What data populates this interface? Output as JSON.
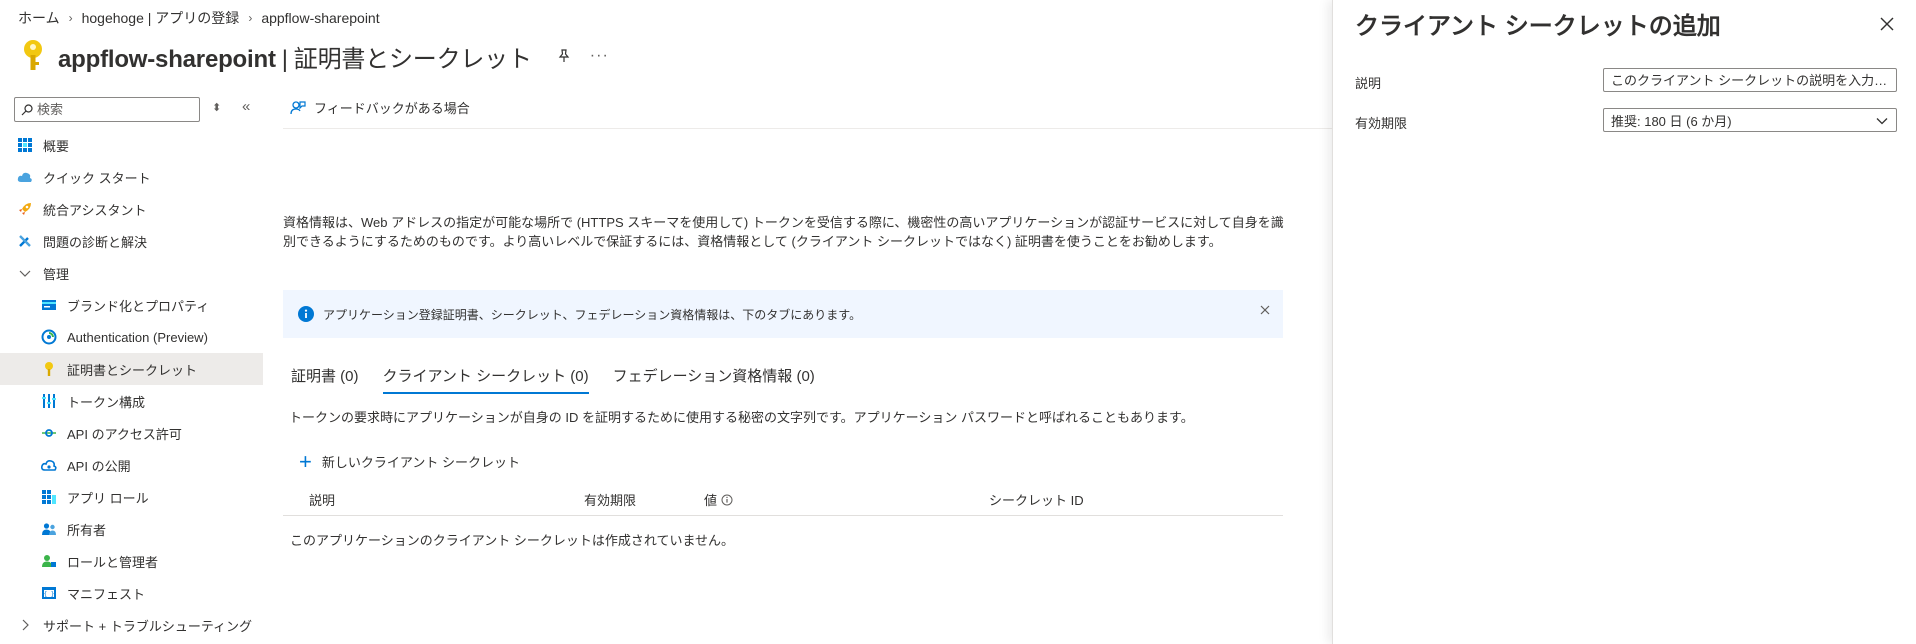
{
  "breadcrumb": {
    "items": [
      "ホーム",
      "hogehoge | アプリの登録",
      "appflow-sharepoint"
    ],
    "separator": "›"
  },
  "header": {
    "app_name": "appflow-sharepoint",
    "bar": "|",
    "section": "証明書とシークレット",
    "more": "···"
  },
  "sidebar": {
    "search_placeholder": "検索",
    "items": [
      {
        "label": "概要",
        "icon": "grid-icon",
        "level": "top"
      },
      {
        "label": "クイック スタート",
        "icon": "cloud-icon",
        "level": "top"
      },
      {
        "label": "統合アシスタント",
        "icon": "rocket-icon",
        "level": "top"
      },
      {
        "label": "問題の診断と解決",
        "icon": "wrench-icon",
        "level": "top"
      },
      {
        "label": "管理",
        "icon": "chevron-down-icon",
        "level": "group"
      },
      {
        "label": "ブランド化とプロパティ",
        "icon": "card-icon",
        "level": "child"
      },
      {
        "label": "Authentication (Preview)",
        "icon": "auth-icon",
        "level": "child"
      },
      {
        "label": "証明書とシークレット",
        "icon": "key-icon",
        "level": "child",
        "active": true
      },
      {
        "label": "トークン構成",
        "icon": "bars-icon",
        "level": "child"
      },
      {
        "label": "API のアクセス許可",
        "icon": "api-icon",
        "level": "child"
      },
      {
        "label": "API の公開",
        "icon": "cloud-expose-icon",
        "level": "child"
      },
      {
        "label": "アプリ ロール",
        "icon": "roles-icon",
        "level": "child"
      },
      {
        "label": "所有者",
        "icon": "owners-icon",
        "level": "child"
      },
      {
        "label": "ロールと管理者",
        "icon": "admin-icon",
        "level": "child"
      },
      {
        "label": "マニフェスト",
        "icon": "manifest-icon",
        "level": "child"
      },
      {
        "label": "サポート + トラブルシューティング",
        "icon": "chevron-right-icon",
        "level": "group"
      }
    ]
  },
  "main": {
    "feedback_label": "フィードバックがある場合",
    "description": "資格情報は、Web アドレスの指定が可能な場所で (HTTPS スキーマを使用して) トークンを受信する際に、機密性の高いアプリケーションが認証サービスに対して自身を識別できるようにするためのものです。より高いレベルで保証するには、資格情報として (クライアント シークレットではなく) 証明書を使うことをお勧めします。",
    "info_message": "アプリケーション登録証明書、シークレット、フェデレーション資格情報は、下のタブにあります。",
    "tabs": [
      {
        "label": "証明書 (0)",
        "active": false
      },
      {
        "label": "クライアント シークレット (0)",
        "active": true
      },
      {
        "label": "フェデレーション資格情報 (0)",
        "active": false
      }
    ],
    "tab_description": "トークンの要求時にアプリケーションが自身の ID を証明するために使用する秘密の文字列です。アプリケーション パスワードと呼ばれることもあります。",
    "new_secret_label": "新しいクライアント シークレット",
    "table_headers": [
      "説明",
      "有効期限",
      "値",
      "シークレット ID"
    ],
    "empty_message": "このアプリケーションのクライアント シークレットは作成されていません。"
  },
  "panel": {
    "title": "クライアント シークレットの追加",
    "description_label": "説明",
    "description_placeholder": "このクライアント シークレットの説明を入力してください",
    "expiry_label": "有効期限",
    "expiry_value": "推奨: 180 日 (6 か月)"
  },
  "colors": {
    "accent": "#0078d4",
    "info_bg": "#f0f6ff",
    "key": "#f2c811",
    "nav_active": "#edebe9"
  }
}
